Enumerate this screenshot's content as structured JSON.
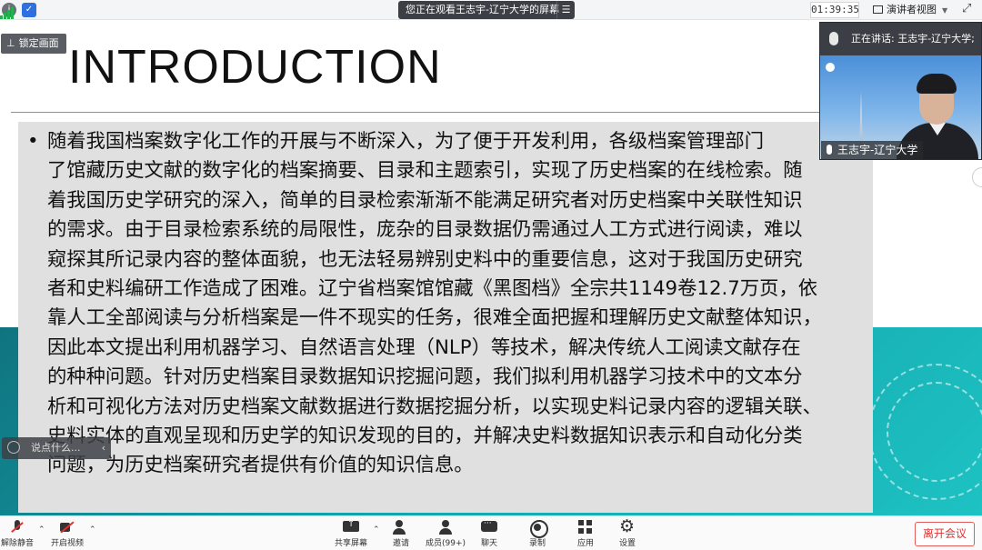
{
  "topbar": {
    "watching": "您正在观看王志宇-辽宁大学的屏幕",
    "timer": "01:39:35",
    "view_label": "演讲者视图"
  },
  "slide": {
    "title": "INTRODUCTION",
    "bullet_char": "•",
    "lines": [
      "随着我国档案数字化工作的开展与不断深入，为了便于开发利用，各级档案管理部门",
      "了馆藏历史文献的数字化的档案摘要、目录和主题索引，实现了历史档案的在线检索。随",
      "着我国历史学研究的深入，简单的目录检索渐渐不能满足研究者对历史档案中关联性知识",
      "的需求。由于目录检索系统的局限性，庞杂的目录数据仍需通过人工方式进行阅读，难以",
      "窥探其所记录内容的整体面貌，也无法轻易辨别史料中的重要信息，这对于我国历史研究",
      "者和史料编研工作造成了困难。辽宁省档案馆馆藏《黑图档》全宗共1149卷12.7万页，依",
      "靠人工全部阅读与分析档案是一件不现实的任务，很难全面把握和理解历史文献整体知识，",
      "因此本文提出利用机器学习、自然语言处理（NLP）等技术，解决传统人工阅读文献存在",
      "的种种问题。针对历史档案目录数据知识挖掘问题，我们拟利用机器学习技术中的文本分",
      "析和可视化方法对历史档案文献数据进行数据挖掘分析，以实现史料记录内容的逻辑关联、",
      "史料实体的直观呈现和历史学的知识发现的目的，并解决史料数据知识表示和自动化分类",
      "问题，为历史档案研究者提供有价值的知识信息。"
    ]
  },
  "lock_screen": "锁定画面",
  "chat_placeholder": "说点什么...",
  "speaker": {
    "speaking_label": "正在讲话: 王志宇-辽宁大学;",
    "name_tag": "王志宇-辽宁大学"
  },
  "toolbar": {
    "unmute": "解除静音",
    "start_video": "开启视频",
    "share_screen": "共享屏幕",
    "invite": "邀请",
    "members": "成员(99+)",
    "chat": "聊天",
    "record": "录制",
    "apps": "应用",
    "settings": "设置",
    "leave": "离开会议"
  },
  "colors": {
    "accent_teal": "#12a2a8",
    "leave_red": "#e0312f"
  }
}
